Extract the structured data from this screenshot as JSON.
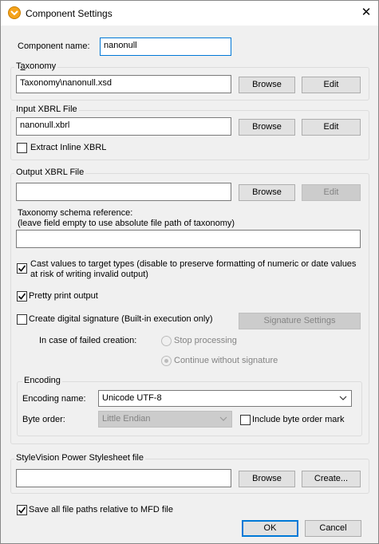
{
  "window": {
    "title": "Component Settings",
    "close_glyph": "✕",
    "app_icon": "mapforce-icon"
  },
  "component_name": {
    "label": "Component name:",
    "value": "nanonull"
  },
  "taxonomy": {
    "legend": "Taxonomy",
    "value": "Taxonomy\\nanonull.xsd",
    "browse": "Browse",
    "edit": "Edit"
  },
  "input_xbrl": {
    "legend": "Input XBRL File",
    "value": "nanonull.xbrl",
    "browse": "Browse",
    "edit": "Edit",
    "extract_inline": {
      "label": "Extract Inline XBRL",
      "checked": false
    }
  },
  "output_xbrl": {
    "legend": "Output XBRL File",
    "value": "",
    "browse": "Browse",
    "edit": "Edit",
    "schema_ref_label_1": "Taxonomy schema reference:",
    "schema_ref_label_2": "(leave field empty to use absolute file path of taxonomy)",
    "schema_ref_value": "",
    "cast_values": {
      "label_1": "Cast values to target types (disable to preserve formatting of numeric or date values",
      "label_2": "at risk of writing invalid output)",
      "checked": true
    },
    "pretty_print": {
      "label": "Pretty print output",
      "checked": true
    },
    "digital_signature": {
      "label": "Create digital signature (Built-in execution only)",
      "checked": false
    },
    "signature_settings": "Signature Settings",
    "failed_creation_label": "In case of failed creation:",
    "stop_processing": "Stop processing",
    "continue_without": "Continue without signature",
    "encoding": {
      "legend": "Encoding",
      "name_label": "Encoding name:",
      "name_value": "Unicode UTF-8",
      "byte_order_label": "Byte order:",
      "byte_order_value": "Little Endian",
      "include_bom": {
        "label": "Include byte order mark",
        "checked": false
      }
    }
  },
  "stylevision": {
    "legend": "StyleVision Power Stylesheet file",
    "value": "",
    "browse": "Browse",
    "create": "Create..."
  },
  "save_relative": {
    "label": "Save all file paths relative to MFD file",
    "checked": true
  },
  "footer": {
    "ok": "OK",
    "cancel": "Cancel"
  }
}
